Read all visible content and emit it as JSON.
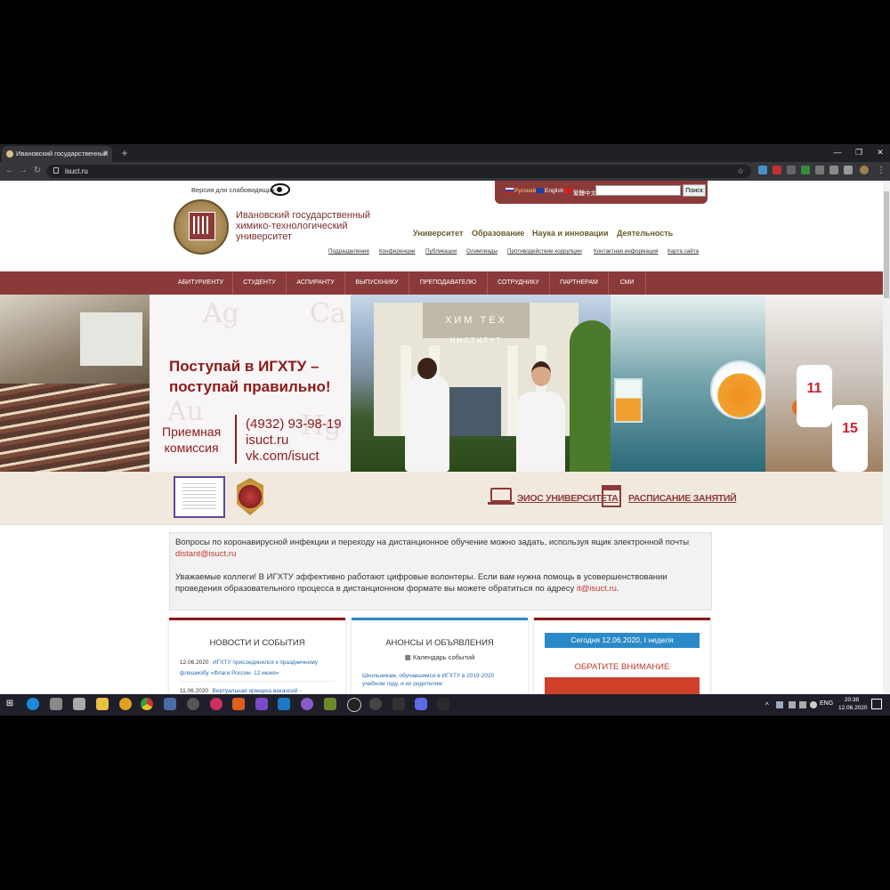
{
  "browser": {
    "tab_title": "Ивановский государственный",
    "url": "isuct.ru"
  },
  "header": {
    "low_vision_link": "Версия для слабовидящих",
    "languages": [
      "Русский",
      "English",
      "繁體中文"
    ],
    "search_placeholder": "",
    "search_button": "Поиск",
    "university_name": "Ивановский государственный химико-технологический университет",
    "top_nav": [
      "Университет",
      "Образование",
      "Наука и инновации",
      "Деятельность"
    ],
    "sub_links": [
      "Подразделения",
      "Конференции",
      "Публикации",
      "Олимпиады",
      "Противодействие коррупции",
      "Контактная информация",
      "Карта сайта"
    ]
  },
  "main_nav": [
    "АБИТУРИЕНТУ",
    "СТУДЕНТУ",
    "АСПИРАНТУ",
    "ВЫПУСКНИКУ",
    "ПРЕПОДАВАТЕЛЮ",
    "СОТРУДНИКУ",
    "ПАРТНЕРАМ",
    "СМИ"
  ],
  "banner": {
    "slogan": "Поступай в ИГХТУ – поступай правильно!",
    "admission_line1": "Приемная",
    "admission_line2": "комиссия",
    "phone": "(4932) 93-98-19",
    "site": "isuct.ru",
    "vk": "vk.com/isuct",
    "building_sign": "ХИМ ТЕХ",
    "building_sign2": "ИНСТИТУТ",
    "jersey1": "11",
    "jersey2": "15",
    "elements": [
      "Ag",
      "Ca",
      "Au",
      "Hg"
    ]
  },
  "quick_links": {
    "eios": "ЭИОС УНИВЕРСИТЕТА",
    "schedule": "РАСПИСАНИЕ ЗАНЯТИЙ"
  },
  "notice": {
    "p1_text": "Вопросы по коронавирусной инфекции и переходу на дистанционное обучение можно задать, используя ящик электронной почты",
    "p1_email": "distant@isuct.ru",
    "p2_text": "Уважаемые коллеги! В ИГХТУ эффективно работают цифровые волонтеры. Если вам нужна помощь в усовершенствовании проведения образовательного процесса в дистанционном формате вы можете обратиться по адресу",
    "p2_email": "it@isuct.ru"
  },
  "columns": {
    "news_title": "НОВОСТИ И СОБЫТИЯ",
    "news": [
      {
        "date": "12.06.2020",
        "text": "ИГХТУ присоединился к праздничному флешмобу «Флаги России. 12 июня»"
      },
      {
        "date": "11.06.2020",
        "text": "Виртуальная ярмарка вакансий -"
      }
    ],
    "announce_title": "АНОНСЫ И ОБЪЯВЛЕНИЯ",
    "calendar_link": "Календарь событий",
    "announce_item": "Школьникам, обучавшимся в ИГХТУ в 2019-2020 учебном году, и их родителям",
    "today": "Сегодня 12.06.2020,  I неделя",
    "attention": "ОБРАТИТЕ ВНИМАНИЕ"
  },
  "taskbar": {
    "lang": "ENG",
    "time": "20:38",
    "date": "12.06.2020"
  },
  "colors": {
    "brand": "#8b3a3a",
    "accent_blue": "#2a8ac8",
    "alert_red": "#c0392b"
  }
}
